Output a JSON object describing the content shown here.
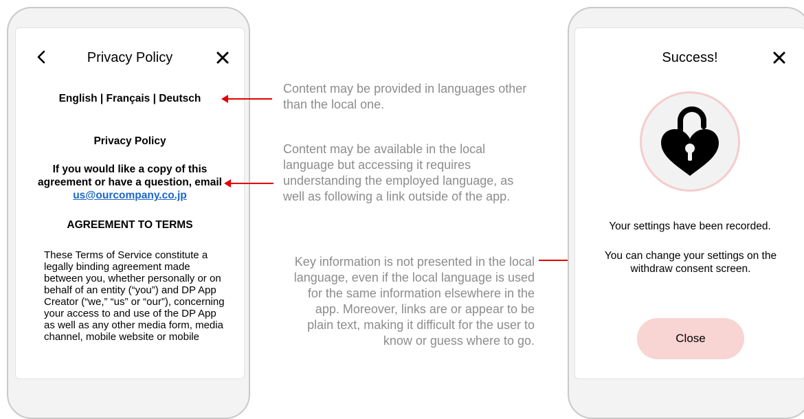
{
  "left_phone": {
    "header_title": "Privacy Policy",
    "languages": "English | Français | Deutsch",
    "privacy_heading": "Privacy Policy",
    "copy_text": "If you would like a copy of this agreement or have a question, email",
    "email_link": "us@ourcompany.co.jp",
    "terms_heading": "AGREEMENT TO TERMS",
    "terms_body": "These Terms of Service constitute a legally binding agreement made between you, whether personally or on behalf of an entity (“you”) and DP App Creator (“we,” “us” or “our”), concerning your access to and use of the DP App as well as any other media form, media channel, mobile website or mobile"
  },
  "annotations": {
    "note1": "Content may be provided in languages other than the local one.",
    "note2": "Content may be available in the local language but accessing it requires understanding the employed language, as well as following a link outside of the app.",
    "note3": "Key information is not presented in the local language, even if the local language is used for the same information elsewhere in the app. Moreover, links are or appear to be plain text, making it difficult for the user to know or guess where to go."
  },
  "right_phone": {
    "header_title": "Success!",
    "message1": "Your settings have been recorded.",
    "message2": "You can change your settings on the withdraw consent screen.",
    "close_button": "Close",
    "icon": "heart-lock-open-icon"
  },
  "colors": {
    "arrow": "#e30000",
    "annotation_text": "#8c8c8c",
    "link": "#1a66c8",
    "button_bg": "#f8d4d3",
    "icon_ring": "#f5cccc"
  }
}
